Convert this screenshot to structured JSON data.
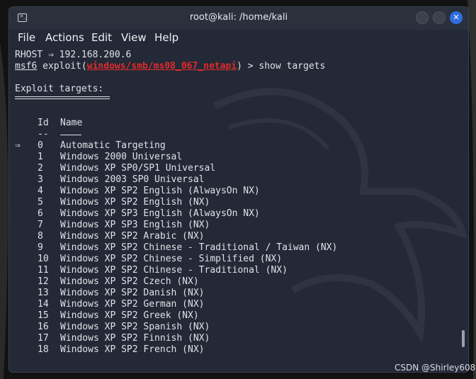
{
  "window": {
    "title": "root@kali: /home/kali"
  },
  "menu": [
    "File",
    "Actions",
    "Edit",
    "View",
    "Help"
  ],
  "terminal": {
    "rhost_line": "RHOST ⇒ 192.168.200.6",
    "prompt_name": "msf6",
    "prompt_pre": " exploit(",
    "prompt_module": "windows/smb/ms08_067_netapi",
    "prompt_post": ") > show targets",
    "section_title": "Exploit targets:",
    "col_id": "Id",
    "col_name": "Name",
    "id_underline": "--",
    "selected_marker": "⇒",
    "targets": [
      {
        "id": "0",
        "name": "Automatic Targeting"
      },
      {
        "id": "1",
        "name": "Windows 2000 Universal"
      },
      {
        "id": "2",
        "name": "Windows XP SP0/SP1 Universal"
      },
      {
        "id": "3",
        "name": "Windows 2003 SP0 Universal"
      },
      {
        "id": "4",
        "name": "Windows XP SP2 English (AlwaysOn NX)"
      },
      {
        "id": "5",
        "name": "Windows XP SP2 English (NX)"
      },
      {
        "id": "6",
        "name": "Windows XP SP3 English (AlwaysOn NX)"
      },
      {
        "id": "7",
        "name": "Windows XP SP3 English (NX)"
      },
      {
        "id": "8",
        "name": "Windows XP SP2 Arabic (NX)"
      },
      {
        "id": "9",
        "name": "Windows XP SP2 Chinese - Traditional / Taiwan (NX)"
      },
      {
        "id": "10",
        "name": "Windows XP SP2 Chinese - Simplified (NX)"
      },
      {
        "id": "11",
        "name": "Windows XP SP2 Chinese - Traditional (NX)"
      },
      {
        "id": "12",
        "name": "Windows XP SP2 Czech (NX)"
      },
      {
        "id": "13",
        "name": "Windows XP SP2 Danish (NX)"
      },
      {
        "id": "14",
        "name": "Windows XP SP2 German (NX)"
      },
      {
        "id": "15",
        "name": "Windows XP SP2 Greek (NX)"
      },
      {
        "id": "16",
        "name": "Windows XP SP2 Spanish (NX)"
      },
      {
        "id": "17",
        "name": "Windows XP SP2 Finnish (NX)"
      },
      {
        "id": "18",
        "name": "Windows XP SP2 French (NX)"
      }
    ]
  },
  "watermark": "CSDN @Shirley608",
  "colors": {
    "accent": "#2f6fe0",
    "module": "#e02b2b",
    "terminal_bg": "#232936"
  },
  "icons": [
    "terminal-icon",
    "minimize-icon",
    "maximize-icon",
    "close-icon"
  ]
}
